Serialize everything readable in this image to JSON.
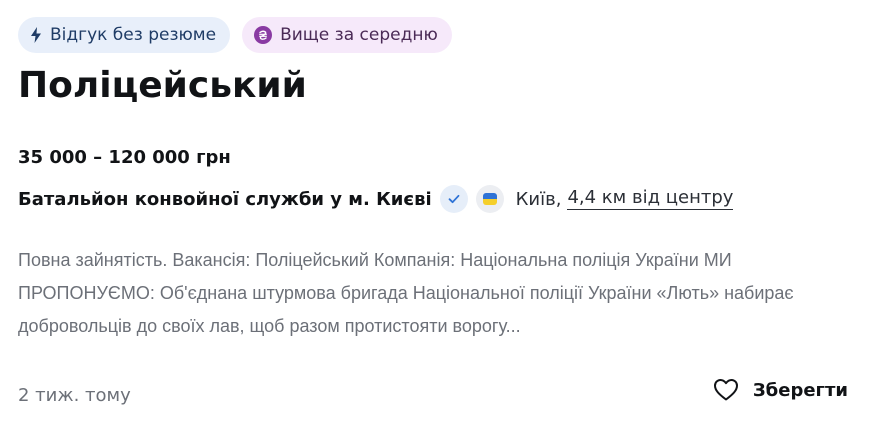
{
  "badges": {
    "no_resume": {
      "label": "Відгук без резюме",
      "icon": "lightning-icon",
      "color": "#1f3c66"
    },
    "above_average": {
      "label": "Вище за середню",
      "icon": "hryvnia-icon",
      "color": "#8a3aa3"
    }
  },
  "vacancy": {
    "title": "Поліцейський",
    "salary": "35 000 – 120 000 грн",
    "company": "Батальйон конвойної служби у м. Києві",
    "city": "Київ,",
    "distance": "4,4 км від центру",
    "description": "Повна зайнятість. Вакансія: Поліцейський Компанія: Національна поліція України МИ ПРОПОНУЄМО: Об'єднана штурмова бригада Національної поліції України «Лють» набирає добровольців до своїх лав, щоб разом протистояти ворогу...",
    "posted": "2 тиж. тому"
  },
  "actions": {
    "save_label": "Зберегти",
    "save_icon": "heart-icon"
  },
  "colors": {
    "badge_blue_bg": "#e8effa",
    "badge_purple_bg": "#f6e9fa",
    "verified_check": "#2f73d6",
    "flag_blue": "#2f73d6",
    "flag_yellow": "#f5cf2a"
  }
}
